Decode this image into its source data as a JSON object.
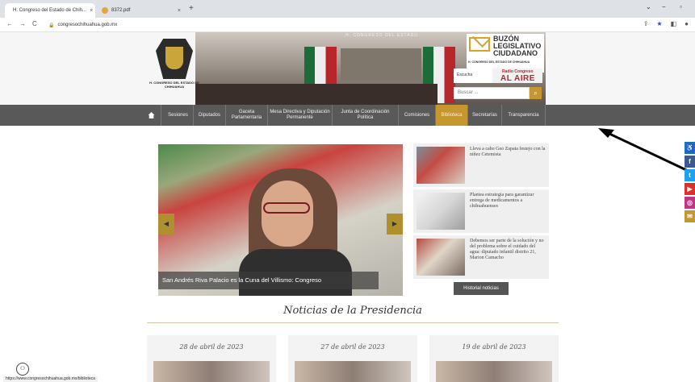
{
  "browser": {
    "tabs": [
      {
        "title": "H. Congreso del Estado de Chih...",
        "active": true
      },
      {
        "title": "8372.pdf",
        "active": false
      }
    ],
    "url": "congresochihuahua.gob.mx",
    "status_url": "https://www.congresochihuahua.gob.mx/biblioteca"
  },
  "header": {
    "logo_text": "H. CONGRESO DEL ESTADO DE CHIHUAHUA",
    "motto": "H. CONGRESO DEL ESTADO",
    "buzon_title": "BUZÓN LEGISLATIVO CIUDADANO",
    "buzon_sub": "H. CONGRESO DEL ESTADO DE CHIHUAHUA",
    "radio_label": "Radio Congreso",
    "radio_main": "AL AIRE",
    "radio_left": "Escucha",
    "search_placeholder": "Buscar ..."
  },
  "nav": [
    "Sesiones",
    "Diputados",
    "Gaceta Parlamentaria",
    "Mesa Directiva y Diputación Permanente",
    "Junta de Coordinación Política",
    "Comisiones",
    "Biblioteca",
    "Secretarías",
    "Transparencia"
  ],
  "slider": {
    "caption": "San Andrés Riva Palacio es la Cuna del Villismo: Congreso",
    "prev": "◀",
    "next": "▶"
  },
  "news": [
    "Lleva a cabo Geo Zapata festejo con la niñez Cetemista",
    "Plantea estrategia para garantizar entrega de medicamentos a chihuahuenses",
    "Debemos ser parte de la solución y no del problema sobre el cuidado del agua: diputado infantil distrito 21, Marion Camacho"
  ],
  "history_button": "Historial noticias",
  "presidencia": {
    "title": "Noticias de la Presidencia",
    "cards": [
      "28 de abril de 2023",
      "27 de abril de 2023",
      "19 de abril de 2023"
    ]
  },
  "social_icons": [
    "accessibility-icon",
    "facebook-icon",
    "twitter-icon",
    "youtube-icon",
    "instagram-icon",
    "mail-icon"
  ],
  "colors": {
    "nav_bg": "#595959",
    "accent_gold": "#c7972f",
    "radio_red": "#b8262b"
  }
}
